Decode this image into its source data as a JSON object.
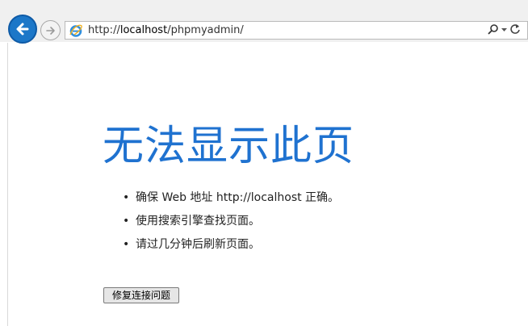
{
  "browser": {
    "address_url_prefix": "http://",
    "address_url_host": "localhost",
    "address_url_path": "/phpmyadmin/",
    "back_icon": "back-arrow-icon",
    "forward_icon": "forward-arrow-icon",
    "site_icon": "ie-logo-icon",
    "search_icon": "search-icon",
    "dropdown_icon": "chevron-down-icon",
    "refresh_icon": "refresh-icon"
  },
  "page": {
    "title": "无法显示此页",
    "tips": [
      "确保 Web 地址 http://localhost 正确。",
      "使用搜索引擎查找页面。",
      "请过几分钟后刷新页面。"
    ],
    "fix_button_label": "修复连接问题"
  },
  "colors": {
    "accent": "#1f72d0",
    "back_button": "#1c77c8"
  }
}
